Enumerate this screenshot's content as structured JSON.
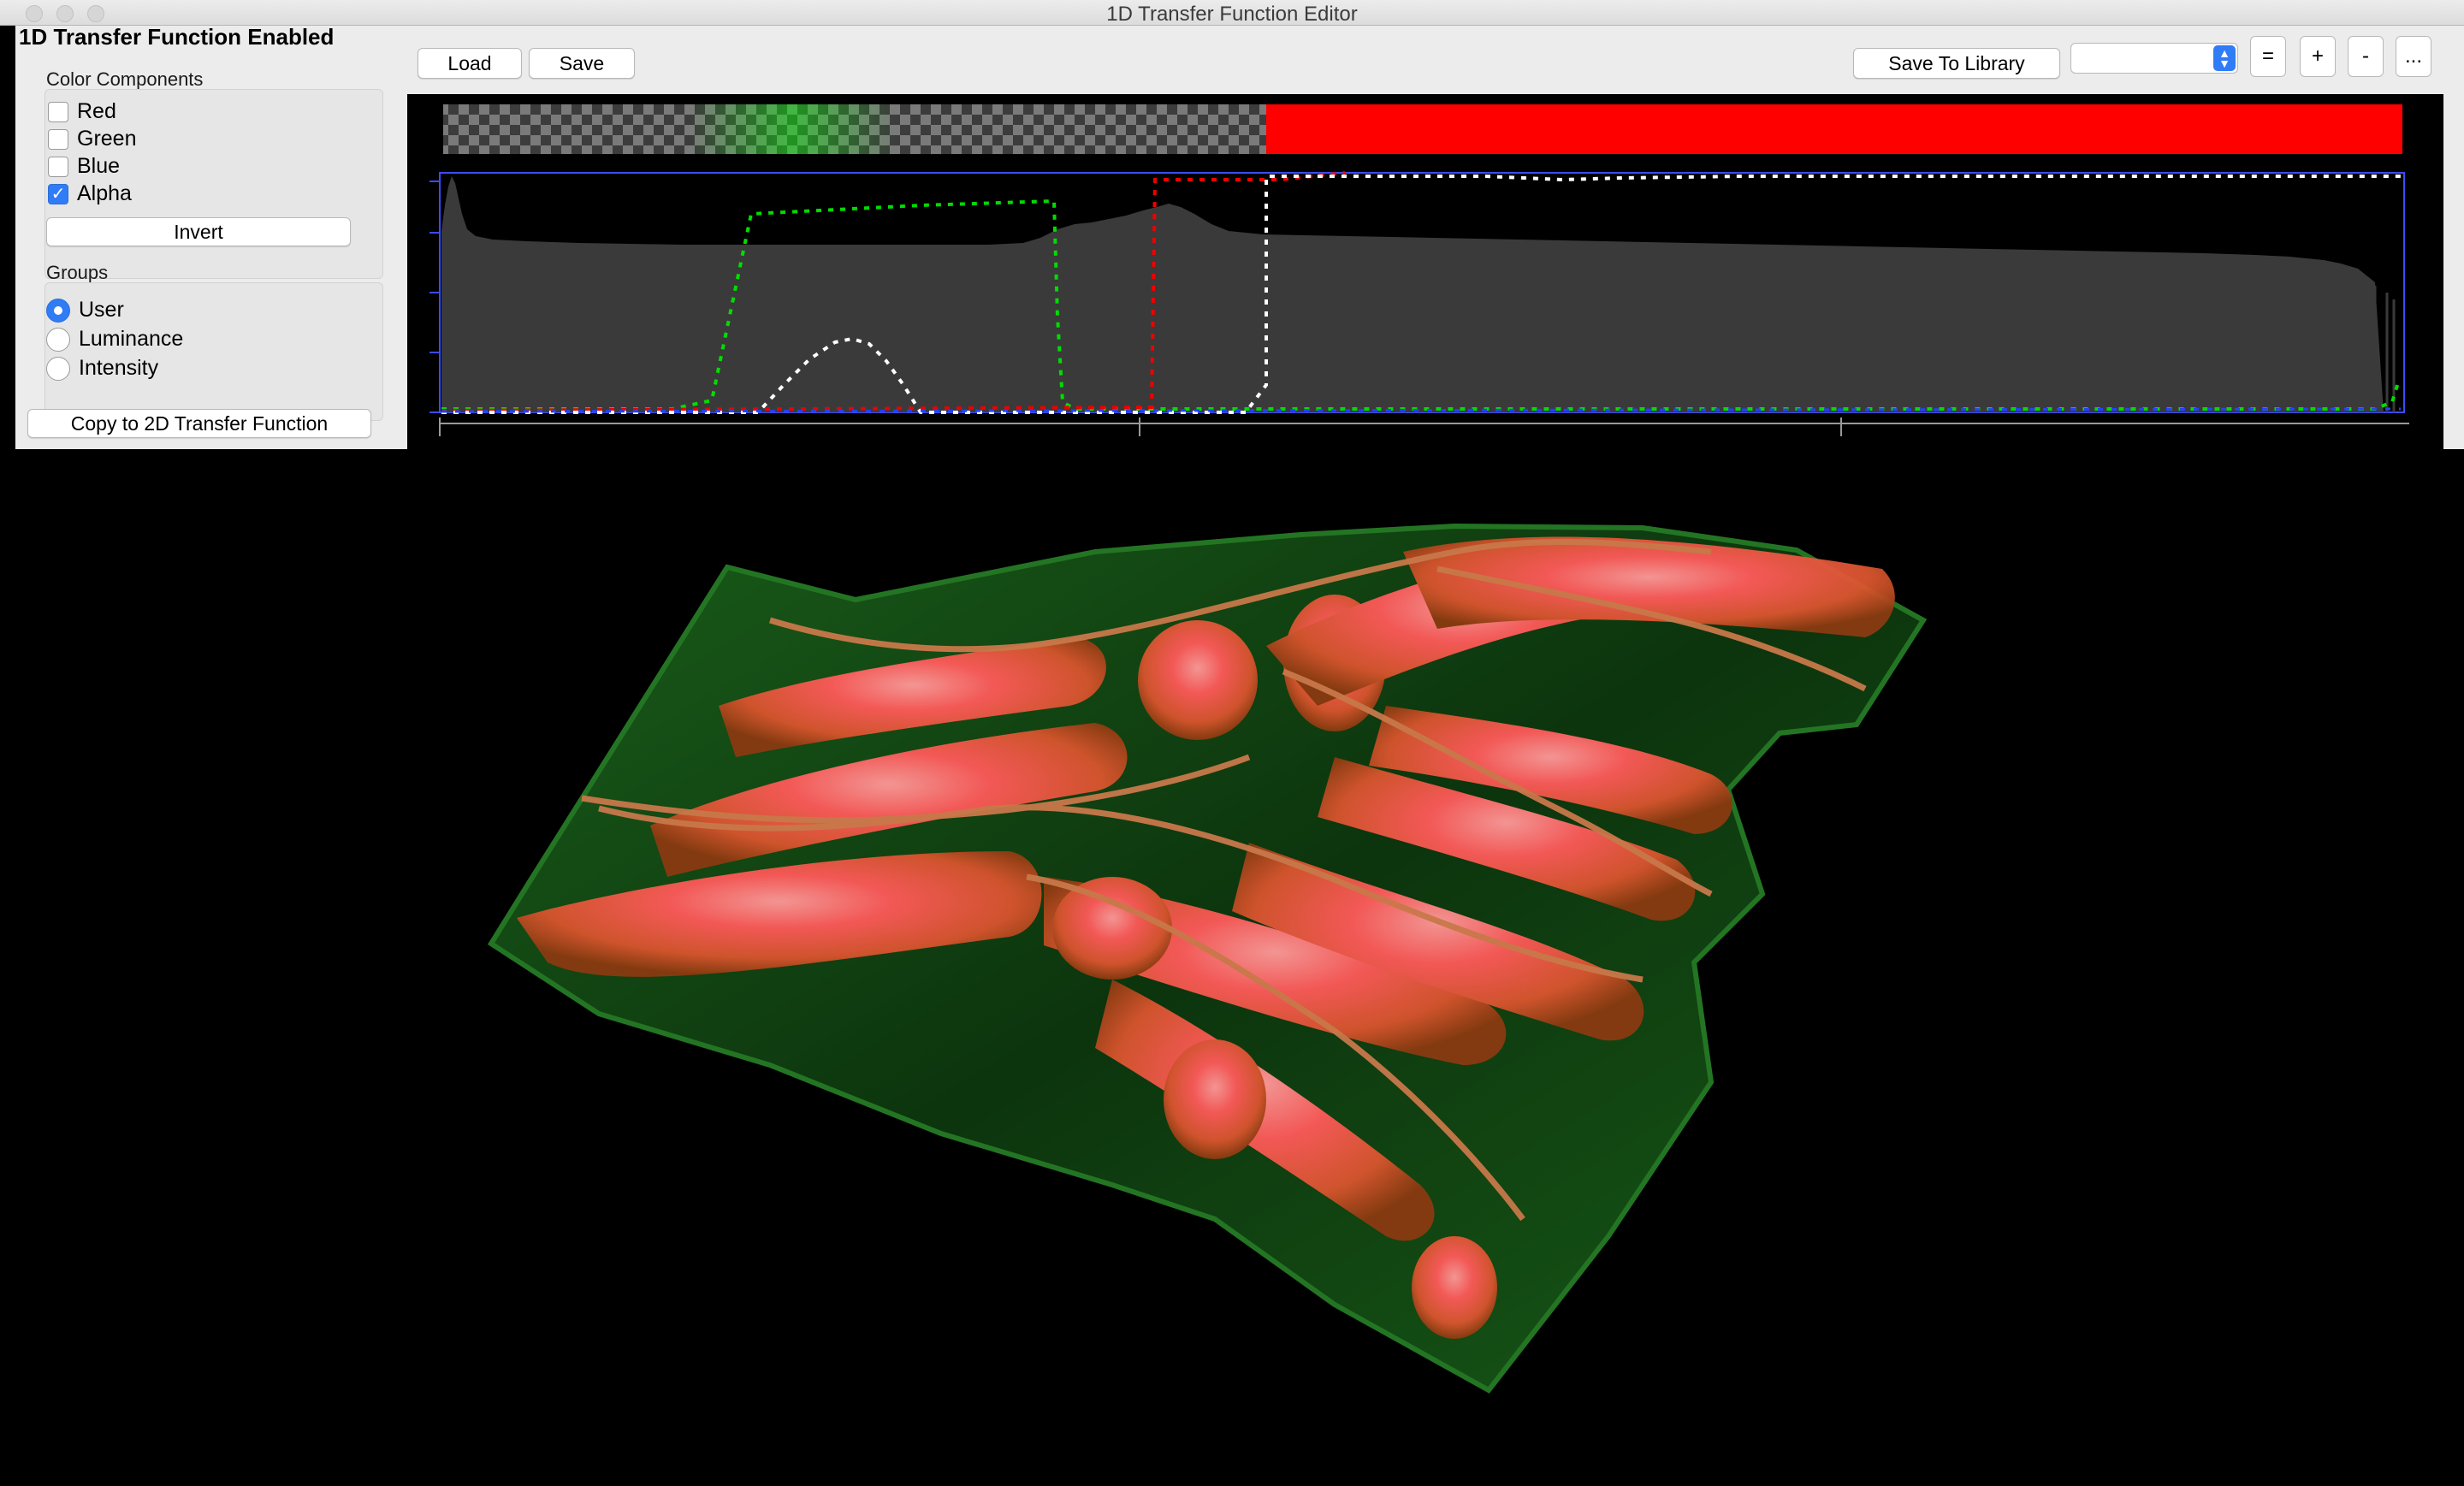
{
  "window": {
    "title": "1D Transfer Function Editor"
  },
  "left_panel": {
    "enabled_label": "1D Transfer Function Enabled",
    "color_components": {
      "title": "Color Components",
      "items": [
        {
          "label": "Red",
          "checked": false
        },
        {
          "label": "Green",
          "checked": false
        },
        {
          "label": "Blue",
          "checked": false
        },
        {
          "label": "Alpha",
          "checked": true
        }
      ],
      "invert_label": "Invert"
    },
    "groups": {
      "title": "Groups",
      "items": [
        {
          "label": "User",
          "selected": true
        },
        {
          "label": "Luminance",
          "selected": false
        },
        {
          "label": "Intensity",
          "selected": false
        }
      ]
    },
    "copy_label": "Copy to 2D Transfer Function"
  },
  "toolbar": {
    "load_label": "Load",
    "save_label": "Save",
    "save_library_label": "Save To Library",
    "library_select_value": "",
    "equal_label": "=",
    "plus_label": "+",
    "minus_label": "-",
    "more_label": "..."
  },
  "colors": {
    "accent": "#2f7cf6",
    "colormap_red": "#ff0000",
    "curve_green": "#00dd00",
    "curve_red": "#ee0000",
    "curve_white": "#ffffff",
    "curve_blue": "#2244ff",
    "histogram_fill": "#3a3a3a"
  },
  "render": {
    "subject": "volume-rendered hand"
  }
}
